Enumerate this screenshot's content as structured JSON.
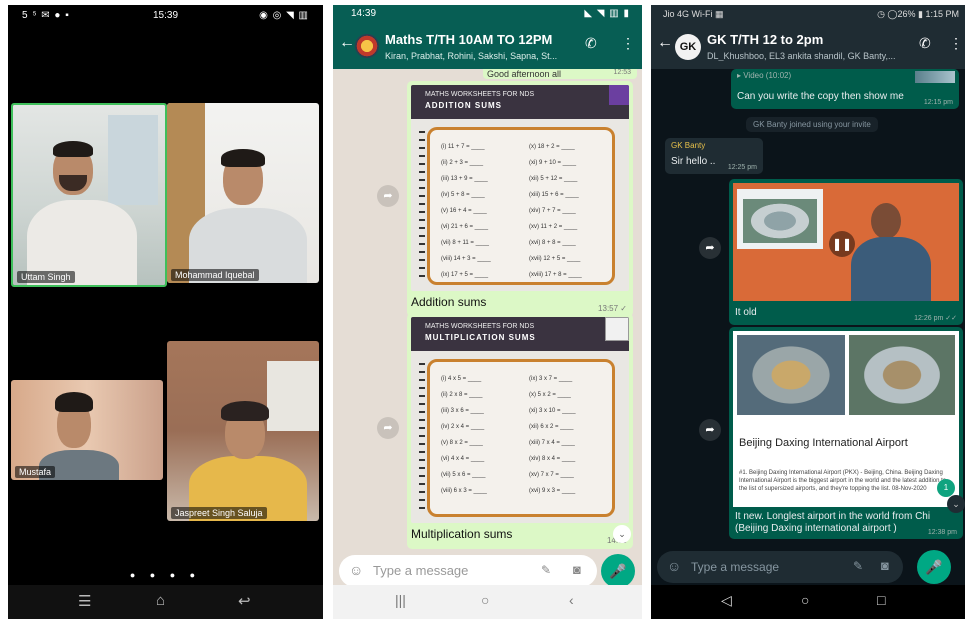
{
  "phone1": {
    "status_left": "5 ⁵ ✉ ● ▪",
    "status_time": "15:39",
    "status_right": "◉ ◎ ◥ ▥",
    "participants": [
      "Uttam Singh",
      "Mohammad Iquebal",
      "Mustafa",
      "Jaspreet Singh Saluja"
    ],
    "page_dots": "● ● ● ●",
    "nav": {
      "menu": "☰",
      "home": "⌂",
      "back": "↩"
    }
  },
  "phone2": {
    "status_time": "14:39",
    "status_right": "◣ ◥ ▥ ▮",
    "chat_title": "Maths T/TH 10AM TO 12PM",
    "chat_subtitle": "Kiran, Prabhat, Rohini, Sakshi, Sapna, St...",
    "partial_message": "Good afternoon all",
    "partial_time": "12:53",
    "messages": [
      {
        "sheet_header": "MATHS WORKSHEETS FOR NDS",
        "sheet_title": "ADDITION SUMS",
        "col1": "(i) 11 + 7 = ____\n(ii) 2 + 3 = ____\n(iii) 13 + 9 = ____\n(iv) 5 + 8 = ____\n(v) 16 + 4 = ____\n(vi) 21 + 6 = ____\n(vii) 8 + 11 = ____\n(viii) 14 + 3 = ____\n(ix) 17 + 5 = ____",
        "col2": "(x) 18 + 2 = ____\n(xi) 9 + 10 = ____\n(xii) 5 + 12 = ____\n(xiii) 15 + 6 = ____\n(xiv) 7 + 7 = ____\n(xv) 11 + 2 = ____\n(xvi) 8 + 8 = ____\n(xvii) 12 + 5 = ____\n(xviii) 17 + 8 = ____",
        "caption": "Addition sums",
        "time": "13:57 ✓"
      },
      {
        "sheet_header": "MATHS WORKSHEETS FOR NDS",
        "sheet_title": "MULTIPLICATION SUMS",
        "col1": "(i) 4 x 5 = ____\n(ii) 2 x 8 = ____\n(iii) 3 x 6 = ____\n(iv) 2 x 4 = ____\n(v) 8 x 2 = ____\n(vi) 4 x 4 = ____\n(vii) 5 x 6 = ____\n(viii) 6 x 3 = ____",
        "col2": "(ix) 3 x 7 = ____\n(x) 5 x 2 = ____\n(xi) 3 x 10 = ____\n(xii) 6 x 2 = ____\n(xiii) 7 x 4 = ____\n(xiv) 8 x 4 = ____\n(xv) 7 x 7 = ____\n(xvi) 9 x 3 = ____",
        "caption": "Multiplication sums",
        "time": "14:00"
      }
    ],
    "forward_icon": "➦",
    "scroll_down": "⌄",
    "input_placeholder": "Type a message",
    "emoji_icon": "☺",
    "attach_icon": "✎",
    "camera_icon": "◙",
    "mic_icon": "🎤",
    "nav": {
      "recent": "|||",
      "home": "○",
      "back": "‹"
    }
  },
  "phone3": {
    "status_left": "Jio 4G Wi-Fi ▦",
    "status_right": "◷ ◯26% ▮ 1:15 PM",
    "chat_title": "GK T/TH 12 to 2pm",
    "chat_subtitle": "DL_Khushboo, EL3 ankita shandil, GK Banty,...",
    "avatar_letters": "GK",
    "video_label": "▸ Video (10:02)",
    "msg1": "Can you write the copy then show me",
    "msg1_time": "12:15 pm",
    "system_note": "GK Banty joined using your invite",
    "sender": "GK Banty",
    "msg2": "Sir hello ..",
    "msg2_time": "12:25 pm",
    "pause_icon": "❚❚",
    "msg3": "It old",
    "msg3_time": "12:26 pm ✓✓",
    "card_title": "Beijing Daxing International Airport",
    "card_body": "#1. Beijing Daxing International Airport (PKX) - Beijing, China. Beijing Daxing International Airport is the biggest airport in the world and the latest addition to the list of supersized airports, and they're topping the list.  08-Nov-2020",
    "msg4": "It new. Longlest airport in the world from Chi (Beijing Daxing international airport )",
    "msg4_time": "12:38 pm",
    "input_placeholder": "Type a message",
    "nav": {
      "back": "◁",
      "home": "○",
      "recent": "□"
    }
  }
}
